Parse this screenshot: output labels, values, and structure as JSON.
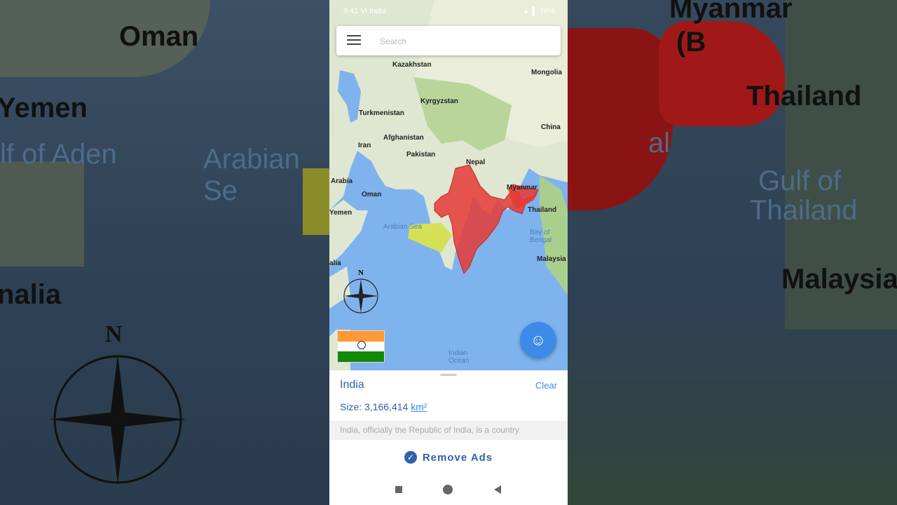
{
  "status_bar": {
    "left_text": "9:41  Vi India  ",
    "right_text": "▲ ▌ 76%"
  },
  "search": {
    "placeholder": "Search"
  },
  "map": {
    "labels": {
      "kazakhstan": "Kazakhstan",
      "mongolia": "Mongolia",
      "turkmenistan": "Turkmenistan",
      "kyrgyzstan": "Kyrgyzstan",
      "china": "China",
      "afghanistan": "Afghanistan",
      "iran": "Iran",
      "pakistan": "Pakistan",
      "nepal": "Nepal",
      "arabia": "Arabia",
      "oman": "Oman",
      "myanmar": "Myanmar",
      "thailand": "Thailand",
      "yemen": "Yemen",
      "arabian_sea": "Arabian Sea",
      "bay_of_bengal": "Bay of Bengal",
      "malaysia": "Malaysia",
      "somalia": "alia",
      "indian_ocean": "Indian Ocean",
      "compass_n": "N"
    },
    "highlight_color": "#e53935",
    "secondary_color": "#d4e157"
  },
  "side_bg": {
    "oman": "Oman",
    "yemen": "Yemen",
    "gulf_of_aden": "lf of Aden",
    "arabian_sea": "Arabian Se",
    "somalia": "nalia",
    "compass_n": "N",
    "myanmar": "Myanmar",
    "burma": "(B",
    "thailand": "Thailand",
    "bengal": "al",
    "gulf_of": "Gulf of",
    "thailand2": "Thailand",
    "malaysia": "Malaysia"
  },
  "sheet": {
    "country": "India",
    "clear_label": "Clear",
    "size_prefix": "Size: 3,166,414 ",
    "size_unit": "km²",
    "description": "India, officially the Republic of India, is a country"
  },
  "remove_ads": {
    "label": "Remove Ads"
  },
  "colors": {
    "accent": "#3062a8",
    "fab": "#3d8ae8"
  }
}
